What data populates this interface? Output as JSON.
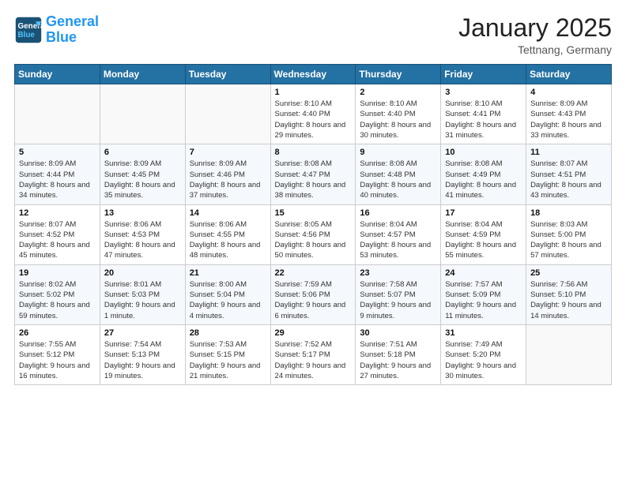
{
  "header": {
    "logo_line1": "General",
    "logo_line2": "Blue",
    "month_title": "January 2025",
    "location": "Tettnang, Germany"
  },
  "weekdays": [
    "Sunday",
    "Monday",
    "Tuesday",
    "Wednesday",
    "Thursday",
    "Friday",
    "Saturday"
  ],
  "weeks": [
    [
      {
        "day": "",
        "info": ""
      },
      {
        "day": "",
        "info": ""
      },
      {
        "day": "",
        "info": ""
      },
      {
        "day": "1",
        "info": "Sunrise: 8:10 AM\nSunset: 4:40 PM\nDaylight: 8 hours and 29 minutes."
      },
      {
        "day": "2",
        "info": "Sunrise: 8:10 AM\nSunset: 4:40 PM\nDaylight: 8 hours and 30 minutes."
      },
      {
        "day": "3",
        "info": "Sunrise: 8:10 AM\nSunset: 4:41 PM\nDaylight: 8 hours and 31 minutes."
      },
      {
        "day": "4",
        "info": "Sunrise: 8:09 AM\nSunset: 4:43 PM\nDaylight: 8 hours and 33 minutes."
      }
    ],
    [
      {
        "day": "5",
        "info": "Sunrise: 8:09 AM\nSunset: 4:44 PM\nDaylight: 8 hours and 34 minutes."
      },
      {
        "day": "6",
        "info": "Sunrise: 8:09 AM\nSunset: 4:45 PM\nDaylight: 8 hours and 35 minutes."
      },
      {
        "day": "7",
        "info": "Sunrise: 8:09 AM\nSunset: 4:46 PM\nDaylight: 8 hours and 37 minutes."
      },
      {
        "day": "8",
        "info": "Sunrise: 8:08 AM\nSunset: 4:47 PM\nDaylight: 8 hours and 38 minutes."
      },
      {
        "day": "9",
        "info": "Sunrise: 8:08 AM\nSunset: 4:48 PM\nDaylight: 8 hours and 40 minutes."
      },
      {
        "day": "10",
        "info": "Sunrise: 8:08 AM\nSunset: 4:49 PM\nDaylight: 8 hours and 41 minutes."
      },
      {
        "day": "11",
        "info": "Sunrise: 8:07 AM\nSunset: 4:51 PM\nDaylight: 8 hours and 43 minutes."
      }
    ],
    [
      {
        "day": "12",
        "info": "Sunrise: 8:07 AM\nSunset: 4:52 PM\nDaylight: 8 hours and 45 minutes."
      },
      {
        "day": "13",
        "info": "Sunrise: 8:06 AM\nSunset: 4:53 PM\nDaylight: 8 hours and 47 minutes."
      },
      {
        "day": "14",
        "info": "Sunrise: 8:06 AM\nSunset: 4:55 PM\nDaylight: 8 hours and 48 minutes."
      },
      {
        "day": "15",
        "info": "Sunrise: 8:05 AM\nSunset: 4:56 PM\nDaylight: 8 hours and 50 minutes."
      },
      {
        "day": "16",
        "info": "Sunrise: 8:04 AM\nSunset: 4:57 PM\nDaylight: 8 hours and 53 minutes."
      },
      {
        "day": "17",
        "info": "Sunrise: 8:04 AM\nSunset: 4:59 PM\nDaylight: 8 hours and 55 minutes."
      },
      {
        "day": "18",
        "info": "Sunrise: 8:03 AM\nSunset: 5:00 PM\nDaylight: 8 hours and 57 minutes."
      }
    ],
    [
      {
        "day": "19",
        "info": "Sunrise: 8:02 AM\nSunset: 5:02 PM\nDaylight: 8 hours and 59 minutes."
      },
      {
        "day": "20",
        "info": "Sunrise: 8:01 AM\nSunset: 5:03 PM\nDaylight: 9 hours and 1 minute."
      },
      {
        "day": "21",
        "info": "Sunrise: 8:00 AM\nSunset: 5:04 PM\nDaylight: 9 hours and 4 minutes."
      },
      {
        "day": "22",
        "info": "Sunrise: 7:59 AM\nSunset: 5:06 PM\nDaylight: 9 hours and 6 minutes."
      },
      {
        "day": "23",
        "info": "Sunrise: 7:58 AM\nSunset: 5:07 PM\nDaylight: 9 hours and 9 minutes."
      },
      {
        "day": "24",
        "info": "Sunrise: 7:57 AM\nSunset: 5:09 PM\nDaylight: 9 hours and 11 minutes."
      },
      {
        "day": "25",
        "info": "Sunrise: 7:56 AM\nSunset: 5:10 PM\nDaylight: 9 hours and 14 minutes."
      }
    ],
    [
      {
        "day": "26",
        "info": "Sunrise: 7:55 AM\nSunset: 5:12 PM\nDaylight: 9 hours and 16 minutes."
      },
      {
        "day": "27",
        "info": "Sunrise: 7:54 AM\nSunset: 5:13 PM\nDaylight: 9 hours and 19 minutes."
      },
      {
        "day": "28",
        "info": "Sunrise: 7:53 AM\nSunset: 5:15 PM\nDaylight: 9 hours and 21 minutes."
      },
      {
        "day": "29",
        "info": "Sunrise: 7:52 AM\nSunset: 5:17 PM\nDaylight: 9 hours and 24 minutes."
      },
      {
        "day": "30",
        "info": "Sunrise: 7:51 AM\nSunset: 5:18 PM\nDaylight: 9 hours and 27 minutes."
      },
      {
        "day": "31",
        "info": "Sunrise: 7:49 AM\nSunset: 5:20 PM\nDaylight: 9 hours and 30 minutes."
      },
      {
        "day": "",
        "info": ""
      }
    ]
  ]
}
